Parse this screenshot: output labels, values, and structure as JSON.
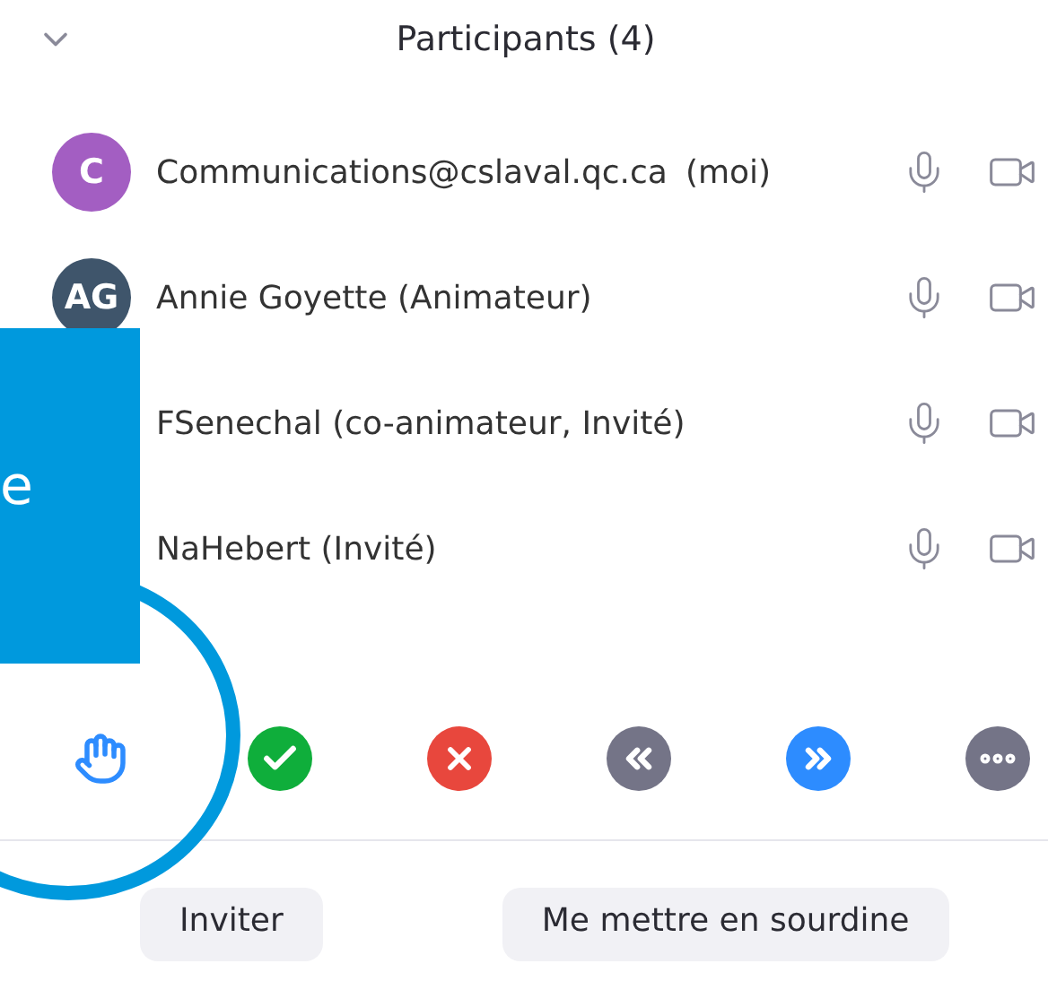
{
  "header": {
    "title": "Participants (4)"
  },
  "participants": [
    {
      "name": "Communications@cslaval.qc.ca",
      "tag": "(moi)",
      "avatar": {
        "initials": "C",
        "color": "#a35ec2"
      }
    },
    {
      "name": "Annie Goyette (Animateur)",
      "avatar": {
        "initials": "AG",
        "color": "#3f556b"
      }
    },
    {
      "name": "FSenechal (co-animateur, Invité)"
    },
    {
      "name": "NaHebert (Invité)"
    }
  ],
  "reactions": [
    {
      "kind": "hand"
    },
    {
      "kind": "yes"
    },
    {
      "kind": "no"
    },
    {
      "kind": "slower"
    },
    {
      "kind": "faster"
    },
    {
      "kind": "more"
    }
  ],
  "buttons": [
    "Inviter",
    "Me mettre en sourdine"
  ],
  "callout": {
    "text": "e"
  }
}
